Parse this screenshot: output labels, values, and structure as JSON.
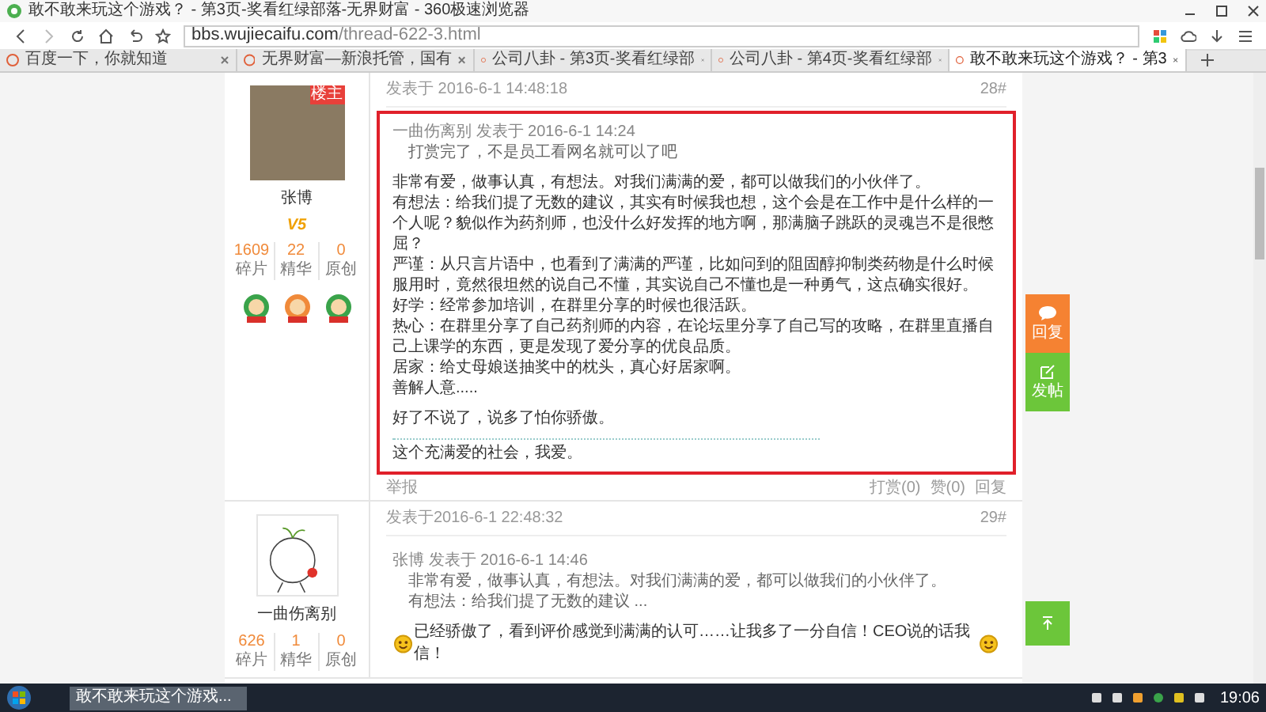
{
  "browser": {
    "title": "敢不敢来玩这个游戏？ - 第3页-奖看红绿部落-无界财富 - 360极速浏览器",
    "url_host": "bbs.wujiecaifu.com",
    "url_path": "/thread-622-3.html",
    "tabs": [
      {
        "label": "百度一下，你就知道",
        "selected": false
      },
      {
        "label": "无界财富—新浪托管，国有",
        "selected": false
      },
      {
        "label": "公司八卦 - 第3页-奖看红绿部",
        "selected": false
      },
      {
        "label": "公司八卦 - 第4页-奖看红绿部",
        "selected": false
      },
      {
        "label": "敢不敢来玩这个游戏？ - 第3",
        "selected": true
      }
    ]
  },
  "posts": [
    {
      "highlighted": true,
      "author": "张博",
      "avatar_tag": "楼主",
      "level": "V5",
      "medals": [
        {
          "color": "#3aa34a"
        },
        {
          "color": "#f08a3a"
        },
        {
          "color": "#3aa34a"
        }
      ],
      "stats": [
        {
          "value": "1609",
          "label": "碎片"
        },
        {
          "value": "22",
          "label": "精华"
        },
        {
          "value": "0",
          "label": "原创"
        }
      ],
      "time": "发表于 2016-6-1 14:48:18",
      "floor": "28#",
      "quote": {
        "source": "一曲伤离别 发表于 2016-6-1 14:24",
        "lines": [
          "打赏完了，不是员工看网名就可以了吧"
        ]
      },
      "paragraphs": [
        "非常有爱，做事认真，有想法。对我们满满的爱，都可以做我们的小伙伴了。",
        "有想法：给我们提了无数的建议，其实有时候我也想，这个会是在工作中是什么样的一个人呢？貌似作为药剂师，也没什么好发挥的地方啊，那满脑子跳跃的灵魂岂不是很憋屈？",
        "严谨：从只言片语中，也看到了满满的严谨，比如问到的阻固醇抑制类药物是什么时候服用时，竟然很坦然的说自己不懂，其实说自己不懂也是一种勇气，这点确实很好。",
        "好学：经常参加培训，在群里分享的时候也很活跃。",
        "热心：在群里分享了自己药剂师的内容，在论坛里分享了自己写的攻略，在群里直播自己上课学的东西，更是发现了爱分享的优良品质。",
        "居家：给丈母娘送抽奖中的枕头，真心好居家啊。",
        "善解人意....."
      ],
      "closing": "好了不说了，说多了怕你骄傲。",
      "signature": "这个充满爱的社会，我爱。",
      "report": "举报",
      "actions": [
        "打赏(0)",
        "赞(0)",
        "回复"
      ]
    },
    {
      "highlighted": false,
      "author": "一曲伤离别",
      "stats": [
        {
          "value": "626",
          "label": "碎片"
        },
        {
          "value": "1",
          "label": "精华"
        },
        {
          "value": "0",
          "label": "原创"
        }
      ],
      "time": "发表于2016-6-1 22:48:32",
      "floor": "29#",
      "quote": {
        "source": "张博 发表于 2016-6-1 14:46",
        "lines": [
          "非常有爱，做事认真，有想法。对我们满满的爱，都可以做我们的小伙伴了。",
          "有想法：给我们提了无数的建议 ..."
        ]
      },
      "message": "已经骄傲了，看到评价感觉到满满的认可……让我多了一分自信！CEO说的话我信！"
    }
  ],
  "side_buttons": [
    {
      "kind": "reply",
      "label": "回复"
    },
    {
      "kind": "post",
      "label": "发帖"
    }
  ],
  "taskbar": {
    "task": "敢不敢来玩这个游戏...",
    "clock": "19:06"
  }
}
